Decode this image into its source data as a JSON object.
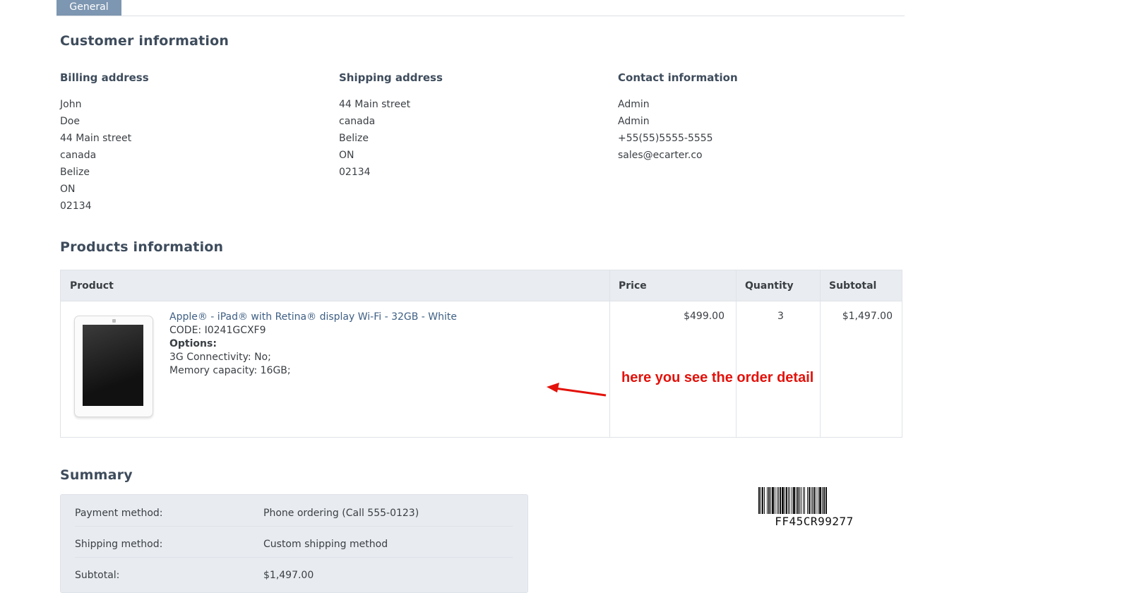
{
  "tabs": {
    "general_label": "General"
  },
  "customer": {
    "title": "Customer information",
    "billing": {
      "title": "Billing address",
      "lines": [
        "John",
        "Doe",
        "44 Main street",
        "canada",
        "Belize",
        "ON",
        "02134"
      ]
    },
    "shipping": {
      "title": "Shipping address",
      "lines": [
        "44 Main street",
        "canada",
        "Belize",
        "ON",
        "02134"
      ]
    },
    "contact": {
      "title": "Contact information",
      "lines": [
        "Admin",
        "Admin",
        "+55(55)5555-5555",
        "sales@ecarter.co"
      ]
    }
  },
  "products": {
    "title": "Products information",
    "columns": {
      "product": "Product",
      "price": "Price",
      "quantity": "Quantity",
      "subtotal": "Subtotal"
    },
    "rows": [
      {
        "name": "Apple® - iPad® with Retina® display Wi-Fi - 32GB - White",
        "code": "CODE: I0241GCXF9",
        "options_label": "Options:",
        "options": [
          "3G Connectivity: No;",
          "Memory capacity: 16GB;"
        ],
        "price": "$499.00",
        "quantity": "3",
        "subtotal": "$1,497.00"
      }
    ]
  },
  "annotation": {
    "text": "here you see the order detail",
    "color": "#e3120b"
  },
  "summary": {
    "title": "Summary",
    "rows": [
      {
        "label": "Payment method:",
        "value": "Phone ordering (Call 555-0123)"
      },
      {
        "label": "Shipping method:",
        "value": "Custom shipping method"
      },
      {
        "label": "Subtotal:",
        "value": "$1,497.00"
      }
    ]
  },
  "barcode": {
    "text": "FF45CR99277"
  },
  "colors": {
    "tab": "#7d96b1",
    "heading": "#3e4c5c",
    "link": "#3e5f84",
    "table_header": "#e9edf2"
  }
}
